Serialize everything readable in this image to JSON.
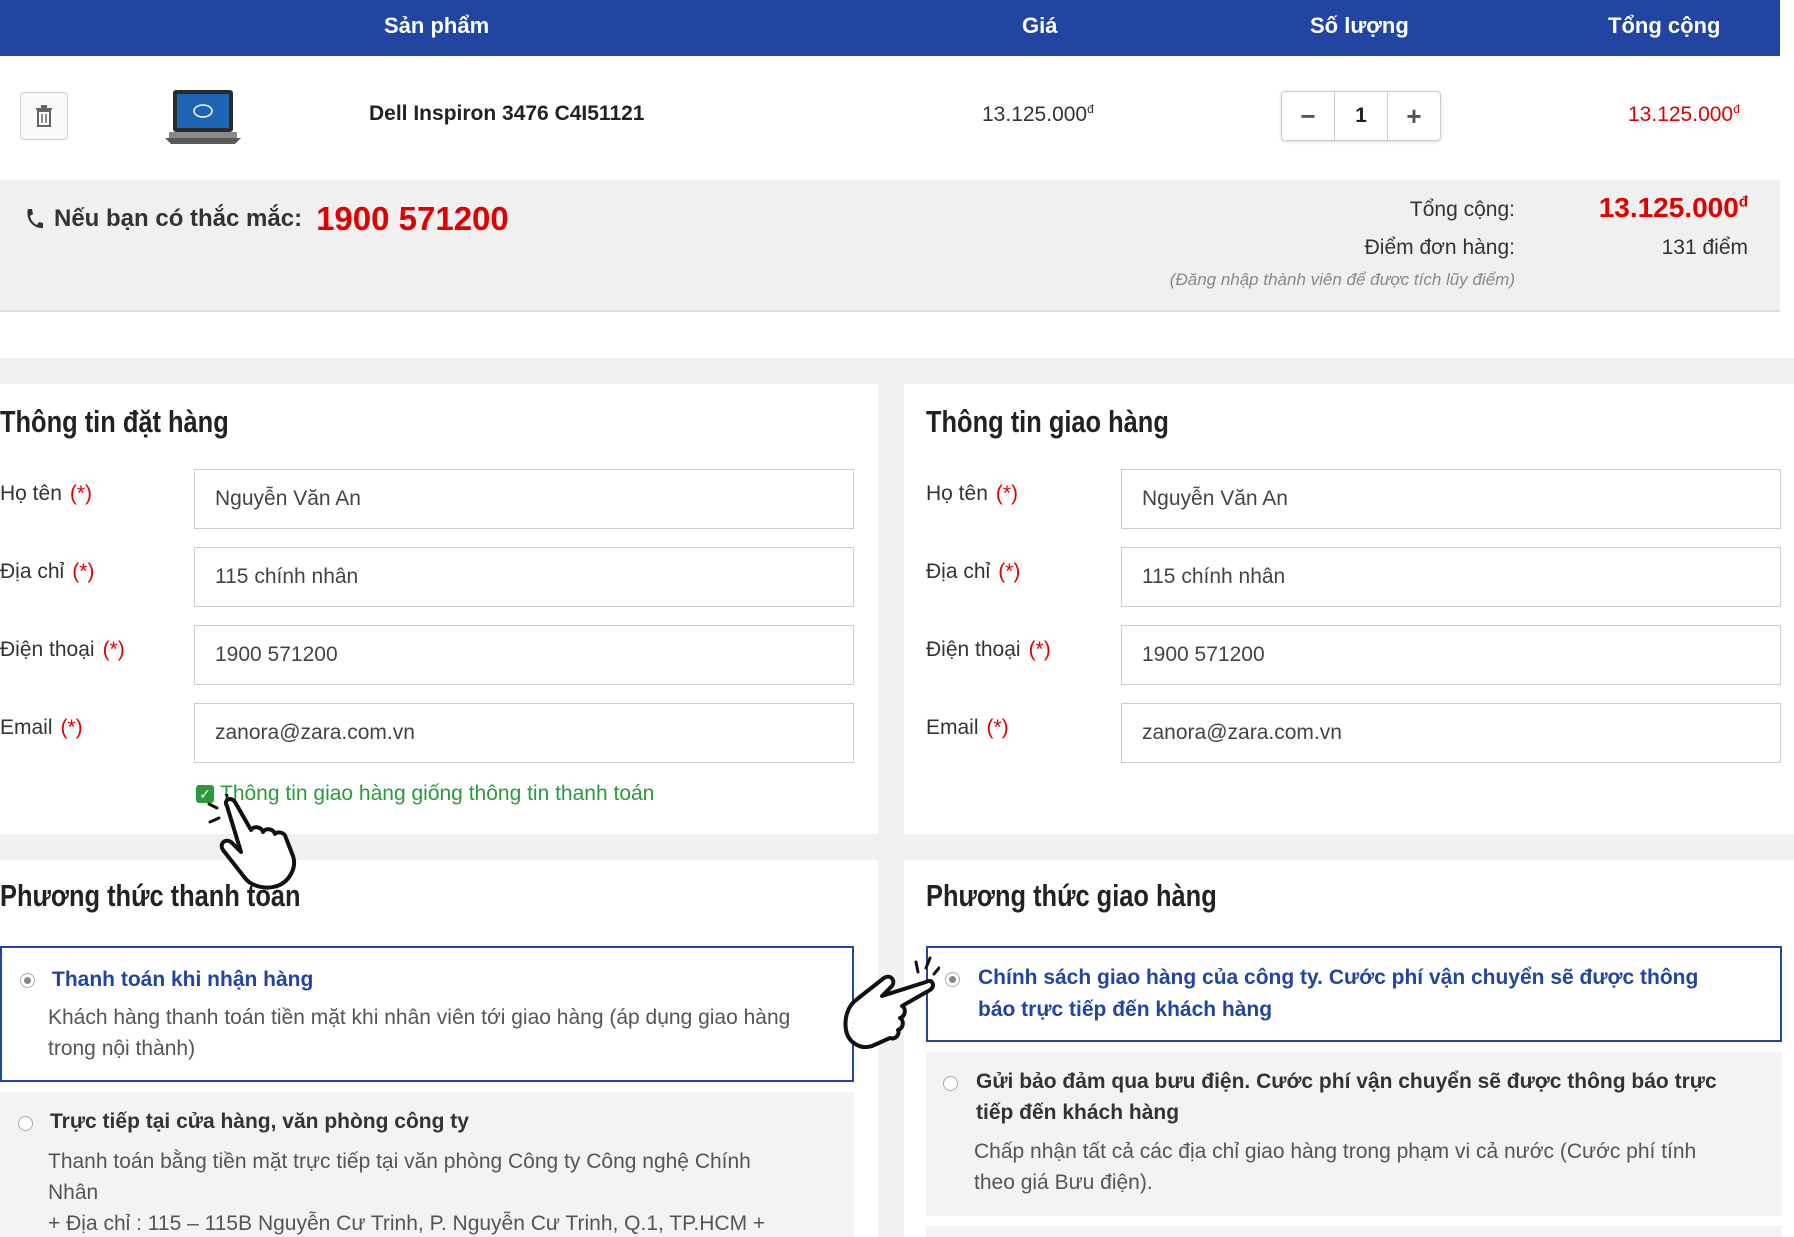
{
  "cart": {
    "headers": {
      "product": "Sản phẩm",
      "price": "Giá",
      "quantity": "Số lượng",
      "total": "Tổng cộng"
    },
    "item": {
      "name": "Dell Inspiron 3476 C4I51121",
      "price": "13.125.000",
      "quantity": "1",
      "total": "13.125.000",
      "currency_sup": "đ",
      "delete_icon": "trash-icon",
      "thumbnail": "laptop-thumbnail"
    },
    "qty_minus": "−",
    "qty_plus": "+"
  },
  "summary": {
    "hotline_label": "Nếu bạn có thắc mắc:",
    "hotline_number": "1900 571200",
    "total_label": "Tổng cộng:",
    "total_value": "13.125.000",
    "points_label": "Điểm đơn hàng:",
    "points_value": "131 điểm",
    "points_note": "(Đăng nhập thành viên để được tích lũy điểm)",
    "colors": {
      "accent": "#2145a0",
      "price": "#e00000"
    }
  },
  "order_info": {
    "title": "Thông tin đặt hàng",
    "fields": [
      {
        "label": "Họ tên",
        "value": "Nguyễn Văn An"
      },
      {
        "label": "Địa chỉ",
        "value": "115 chính nhân"
      },
      {
        "label": "Điện thoại",
        "value": "1900 571200"
      },
      {
        "label": "Email",
        "value": "zanora@zara.com.vn"
      }
    ],
    "required_mark": "(*)",
    "same_as_billing": "Thông tin giao hàng giống thông tin thanh toán",
    "same_checked": true
  },
  "shipping_info": {
    "title": "Thông tin giao hàng",
    "fields": [
      {
        "label": "Họ tên",
        "value": "Nguyễn Văn An"
      },
      {
        "label": "Địa chỉ",
        "value": "115 chính nhân"
      },
      {
        "label": "Điện thoại",
        "value": "1900 571200"
      },
      {
        "label": "Email",
        "value": "zanora@zara.com.vn"
      }
    ]
  },
  "payment": {
    "title": "Phương thức thanh toán",
    "options": [
      {
        "title": "Thanh toán khi nhận hàng",
        "desc_1": "Khách hàng thanh toán tiền mặt khi nhân viên tới giao hàng (áp dụng giao hàng",
        "desc_2": "trong nội thành)",
        "selected": true
      },
      {
        "title": "Trực tiếp tại cửa hàng, văn phòng công ty",
        "desc_1": "Thanh toán bằng tiền mặt trực tiếp tại văn phòng Công ty Công nghệ Chính",
        "desc_2": "Nhân",
        "desc_3": "+ Địa chỉ : 115 – 115B Nguyễn Cư Trinh, P. Nguyễn Cư Trinh, Q.1, TP.HCM  +",
        "selected": false
      }
    ]
  },
  "delivery": {
    "title": "Phương thức giao hàng",
    "options": [
      {
        "title_1": "Chính sách giao hàng của công ty. Cước phí vận chuyển sẽ được thông",
        "title_2": "báo trực tiếp đến khách hàng",
        "selected": true
      },
      {
        "title_1": "Gửi bảo đảm qua bưu điện. Cước phí vận chuyển sẽ được thông báo trực",
        "title_2": "tiếp đến khách hàng",
        "desc_1": "Chấp nhận tất cả các địa chỉ giao hàng trong phạm vi cả nước (Cước phí tính",
        "desc_2": "theo giá Bưu điện).",
        "selected": false
      }
    ]
  },
  "annotations": {
    "hand_pointer_icon": "hand-pointer-icon"
  }
}
